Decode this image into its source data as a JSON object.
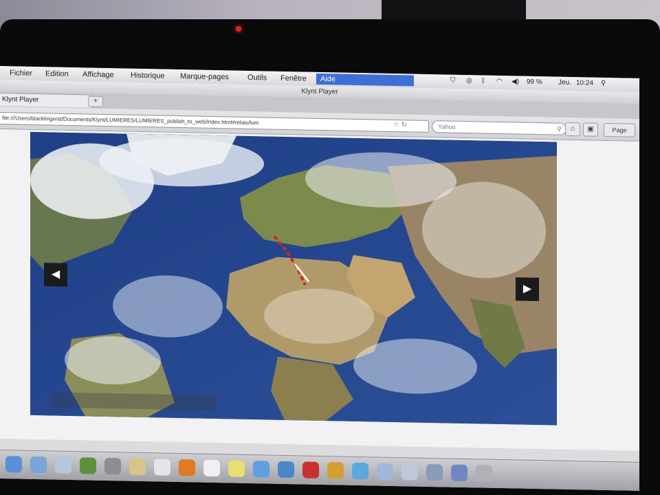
{
  "menubar": {
    "items": [
      "Fichier",
      "Edition",
      "Affichage",
      "Historique",
      "Marque-pages",
      "Outils",
      "Fenêtre",
      "Aide"
    ],
    "status": {
      "battery": "99 %",
      "day": "Jeu.",
      "time": "10:24"
    }
  },
  "window": {
    "title": "Klynt Player"
  },
  "tab": {
    "label": "Klynt Player",
    "new_tab": "+"
  },
  "navbar": {
    "url": "file:///Users/blacklingerid/Documents/Klynt/LUMIERES/LUMIERES_publish_to_web/index.html#relais/lum",
    "search_placeholder": "Yahoo",
    "page_label": "Page"
  },
  "player": {
    "prev_label": "◀",
    "next_label": "▶"
  },
  "dock": {
    "icon_names": [
      "finder-icon",
      "safari-icon",
      "mail-icon",
      "photo-icon",
      "system-preferences-icon",
      "notes-icon",
      "calendar-icon",
      "firefox-icon",
      "document-icon",
      "stickies-icon",
      "itunes-icon",
      "iphoto-icon",
      "app-icon",
      "gallery-icon",
      "quicktime-icon",
      "network-icon",
      "compass-icon",
      "preview-icon",
      "downloads-icon",
      "trash-icon"
    ],
    "icon_colors": [
      "#5a8fd6",
      "#79a6d8",
      "#b7c7d9",
      "#5f8f3f",
      "#8d8d95",
      "#d8c38a",
      "#e4e4e9",
      "#e17b22",
      "#f0f0f2",
      "#e8e070",
      "#5fa0e0",
      "#4c86c8",
      "#c93030",
      "#d1a030",
      "#5aa8e0",
      "#a0b8d8",
      "#c0c8d8",
      "#8a9ab8",
      "#7088c0",
      "#b0b0b8"
    ]
  }
}
